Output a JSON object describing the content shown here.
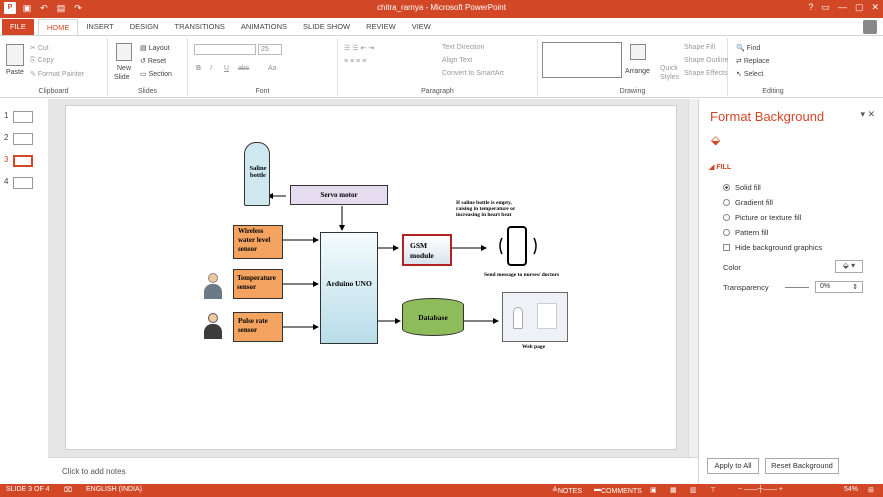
{
  "window": {
    "title": "chitra_ramya - Microsoft PowerPoint",
    "controls": [
      "?",
      "▭",
      "—",
      "▢",
      "✕"
    ]
  },
  "tabs": [
    "FILE",
    "HOME",
    "INSERT",
    "DESIGN",
    "TRANSITIONS",
    "ANIMATIONS",
    "SLIDE SHOW",
    "REVIEW",
    "VIEW"
  ],
  "active_tab": "HOME",
  "ribbon": {
    "clipboard": {
      "label": "Clipboard",
      "paste": "Paste",
      "cut": "Cut",
      "copy": "Copy",
      "format_painter": "Format Painter"
    },
    "slides": {
      "label": "Slides",
      "new_slide": "New",
      "new_slide2": "Slide",
      "layout": "Layout",
      "reset": "Reset",
      "section": "Section"
    },
    "font": {
      "label": "Font",
      "size": "25",
      "bold": "B",
      "italic": "I",
      "underline": "U",
      "strike": "abc",
      "aa": "Aa"
    },
    "paragraph": {
      "label": "Paragraph",
      "text_direction": "Text Direction",
      "align_text": "Align Text",
      "convert_smartart": "Convert to SmartArt"
    },
    "drawing": {
      "label": "Drawing",
      "arrange": "Arrange",
      "quick_styles": "Quick",
      "quick_styles2": "Styles",
      "shape_fill": "Shape Fill",
      "shape_outline": "Shape Outline",
      "shape_effects": "Shape Effects"
    },
    "editing": {
      "label": "Editing",
      "find": "Find",
      "replace": "Replace",
      "select": "Select"
    }
  },
  "thumbnails": [
    "1",
    "2",
    "3",
    "4"
  ],
  "selected_slide": 3,
  "diagram": {
    "saline": "Saline bottle",
    "servo": "Servo motor",
    "wireless": "Wireless water level sensor",
    "temperature": "Temperature sensor",
    "pulse": "Pulse rate sensor",
    "arduino": "Arduino UNO",
    "gsm": "GSM module",
    "database": "Database",
    "condition": "If saline bottle is empty, raising in temperature or increasing in heart beat",
    "send": "Send message to nurses/ doctors",
    "webpage": "Web page"
  },
  "notes_placeholder": "Click to add notes",
  "format_pane": {
    "title": "Format Background",
    "section": "FILL",
    "options": [
      "Solid fill",
      "Gradient fill",
      "Picture or texture fill",
      "Pattern fill"
    ],
    "selected_option": "Solid fill",
    "hide_bg": "Hide background graphics",
    "color_label": "Color",
    "transparency_label": "Transparency",
    "transparency_value": "0%",
    "apply_all": "Apply to All",
    "reset_bg": "Reset Background"
  },
  "status": {
    "slide": "SLIDE 3 OF 4",
    "language": "ENGLISH (INDIA)",
    "notes": "NOTES",
    "comments": "COMMENTS",
    "zoom": "54%"
  },
  "colors": {
    "accent": "#d24726",
    "sensor_box": "#f4a460",
    "arduino_box": "#cfe8ef",
    "gsm_box": "#b22222",
    "database": "#8fbc5a"
  }
}
